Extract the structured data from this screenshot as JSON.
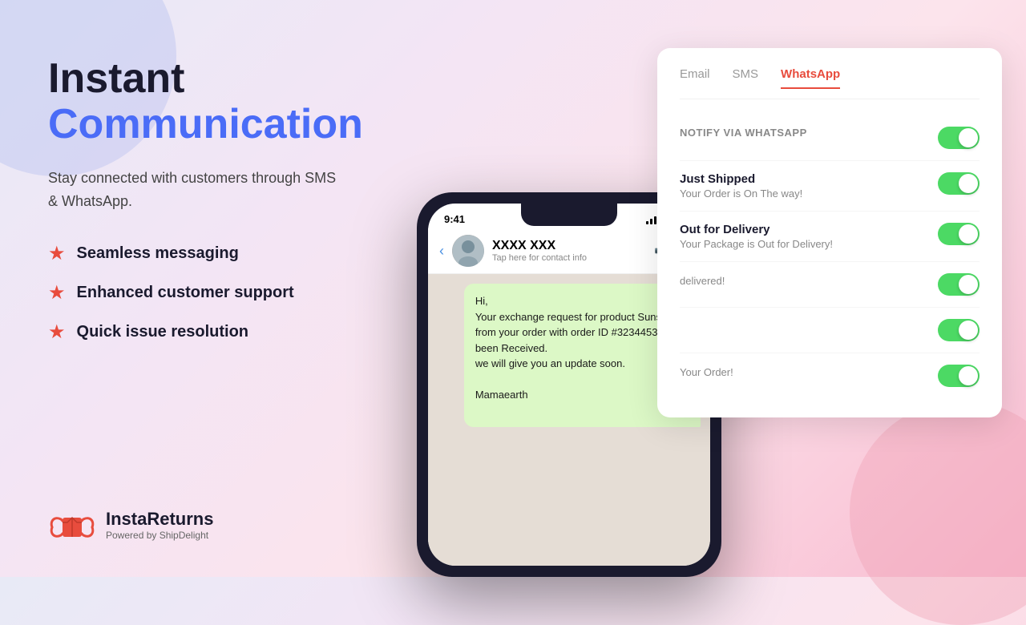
{
  "background": {
    "gradient": "linear-gradient(135deg, #e8eaf6 0%, #f3e5f5 30%, #fce4ec 60%, #f8bbd0 100%)"
  },
  "headline": {
    "line1": "Instant",
    "line2": "Communication"
  },
  "subtitle": "Stay connected with customers through SMS\n& WhatsApp.",
  "features": [
    {
      "id": "seamless",
      "text": "Seamless messaging"
    },
    {
      "id": "customer-support",
      "text": "Enhanced customer support"
    },
    {
      "id": "issue-resolution",
      "text": "Quick issue resolution"
    }
  ],
  "brand": {
    "name": "InstaReturns",
    "tagline": "Powered by ShipDelight"
  },
  "phone": {
    "time": "9:41",
    "contact_name": "XXXX XXX",
    "contact_sub": "Tap here for contact info",
    "message": "Hi,\nYour exchange request for product Sunscreen from your order with order ID #3234453 has been Received.\nwe will give you an update soon.\n\nMamaearth"
  },
  "settings_panel": {
    "tabs": [
      {
        "id": "email",
        "label": "Email",
        "active": false
      },
      {
        "id": "sms",
        "label": "SMS",
        "active": false
      },
      {
        "id": "whatsapp",
        "label": "WhatsApp",
        "active": true
      }
    ],
    "rows": [
      {
        "id": "notify-via-whatsapp",
        "label": "NOTIFY VIA WHATSAPP",
        "title": "",
        "desc": "",
        "toggle": true
      },
      {
        "id": "just-shipped",
        "label": "",
        "title": "Just Shipped",
        "desc": "Your Order is On The way!",
        "toggle": true
      },
      {
        "id": "out-for-delivery",
        "label": "",
        "title": "Out for Delivery",
        "desc": "Your Package is Out for Delivery!",
        "toggle": true
      },
      {
        "id": "row4",
        "label": "",
        "title": "",
        "desc": "delivered!",
        "toggle": true
      },
      {
        "id": "row5",
        "label": "",
        "title": "",
        "desc": "",
        "toggle": true
      },
      {
        "id": "row6",
        "label": "",
        "title": "",
        "desc": "Your Order!",
        "toggle": true
      }
    ]
  }
}
